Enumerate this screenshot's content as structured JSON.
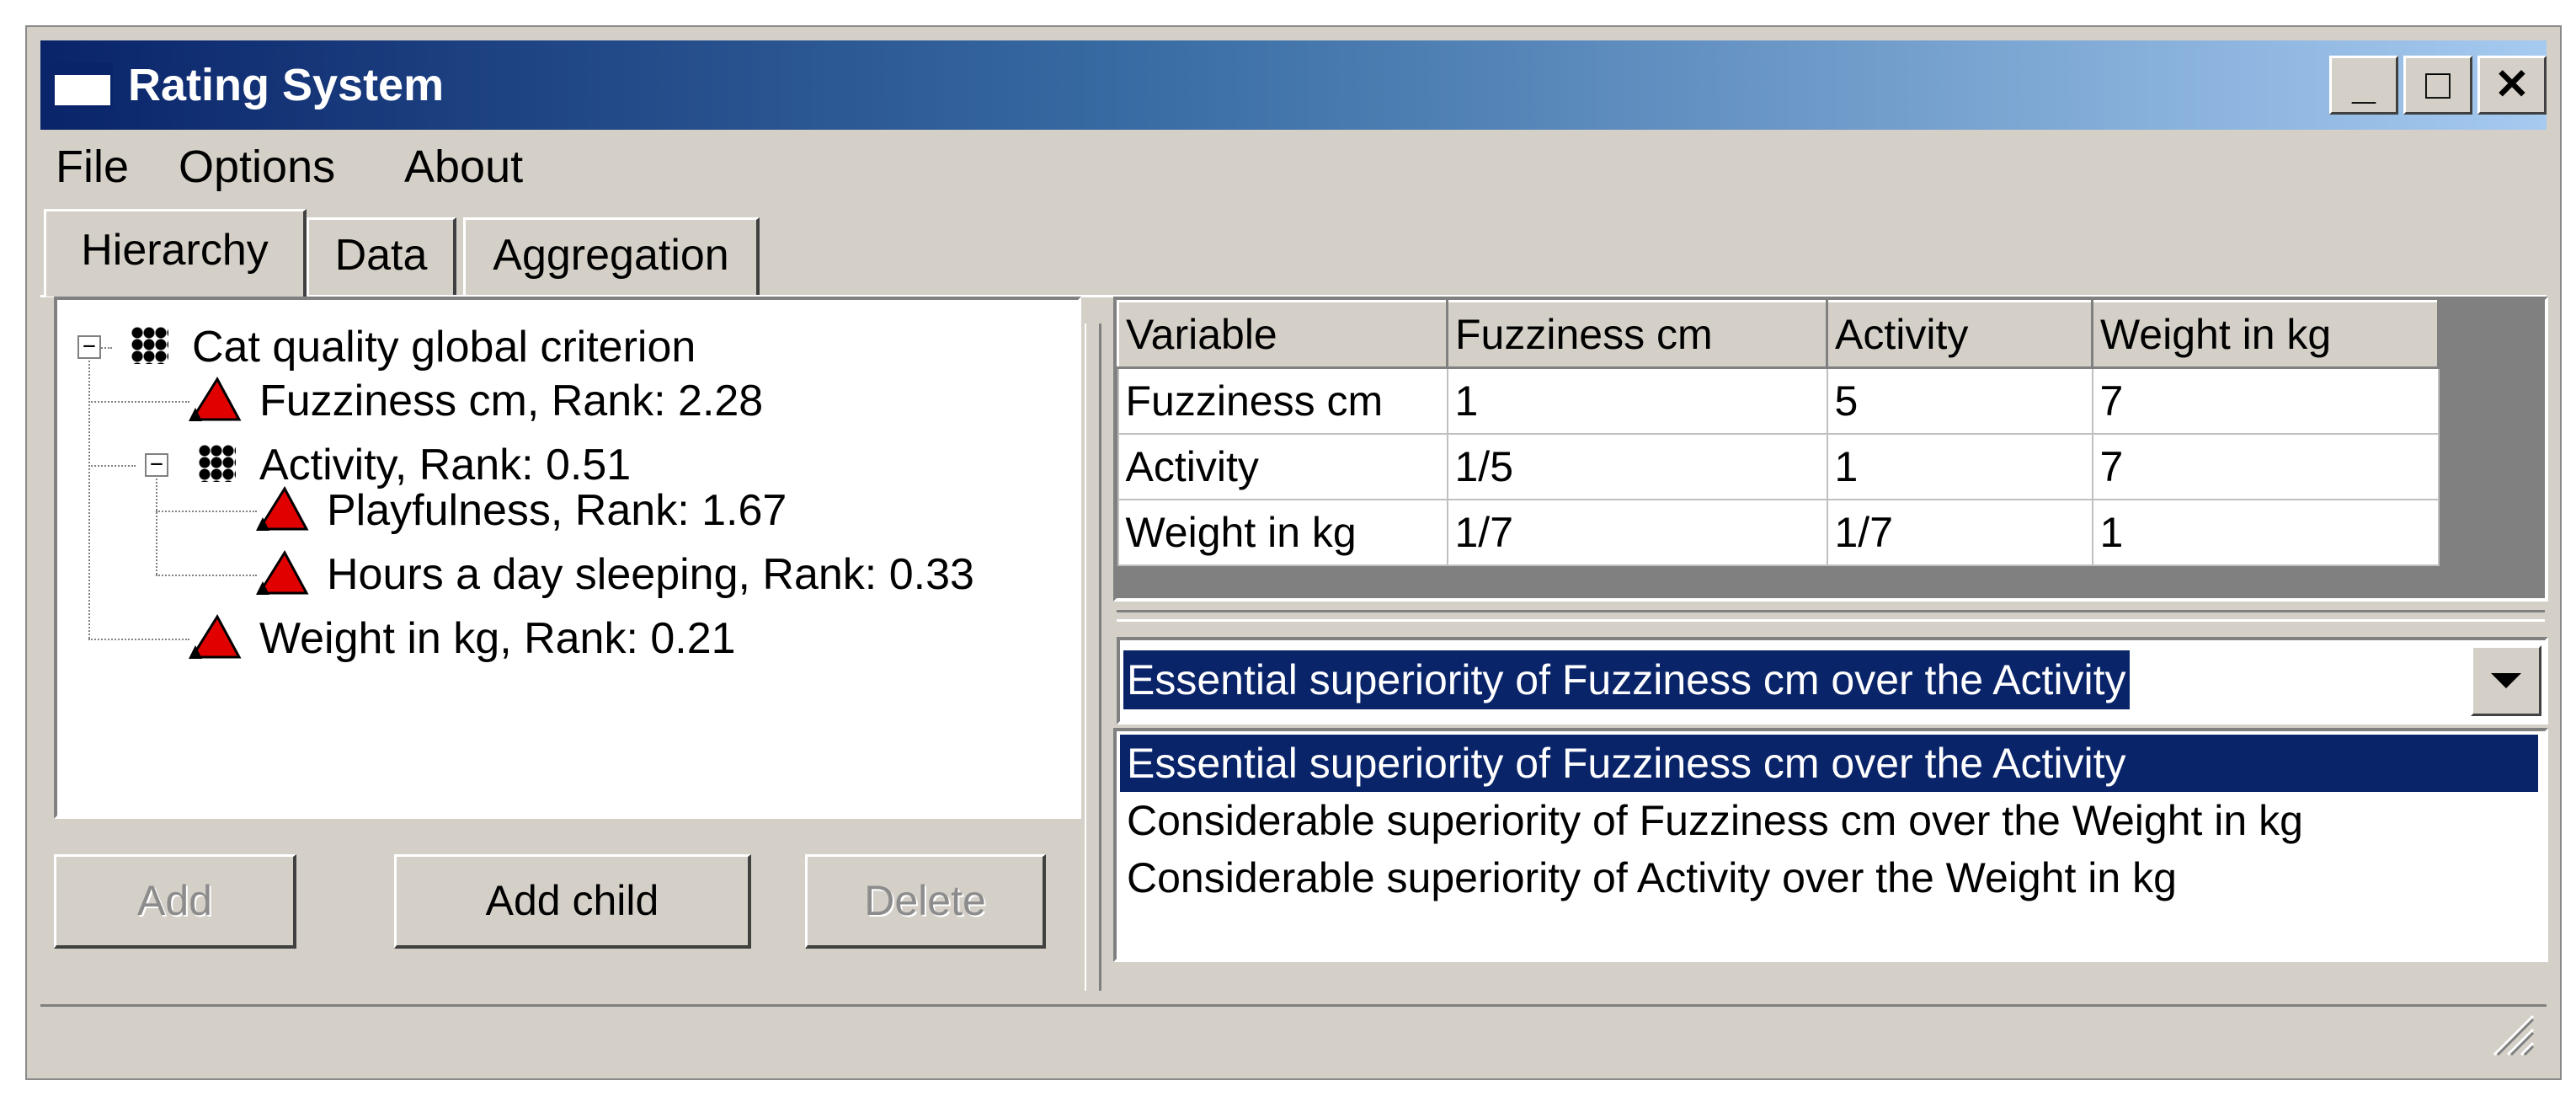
{
  "window": {
    "title": "Rating System"
  },
  "title_buttons": {
    "minimize": "_",
    "maximize": "□",
    "close": "✕"
  },
  "menu": {
    "file": "File",
    "options": "Options",
    "about": "About"
  },
  "tabs": {
    "hierarchy": "Hierarchy",
    "data": "Data",
    "aggregation": "Aggregation"
  },
  "tree": {
    "root": "Cat quality global criterion",
    "fuzziness": "Fuzziness cm, Rank: 2.28",
    "activity": "Activity, Rank: 0.51",
    "playfulness": "Playfulness, Rank: 1.67",
    "sleeping": "Hours a day sleeping, Rank: 0.33",
    "weight": "Weight in kg, Rank: 0.21",
    "expanded_glyph": "−"
  },
  "buttons": {
    "add": "Add",
    "add_child": "Add child",
    "delete": "Delete"
  },
  "matrix": {
    "headers": [
      "Variable",
      "Fuzziness cm",
      "Activity",
      "Weight in kg"
    ],
    "rows": [
      [
        "Fuzziness cm",
        "1",
        "5",
        "7"
      ],
      [
        "Activity",
        "1/5",
        "1",
        "7"
      ],
      [
        "Weight in kg",
        "1/7",
        "1/7",
        "1"
      ]
    ]
  },
  "combo": {
    "selected": "Essential superiority of Fuzziness cm over the Activity"
  },
  "list": {
    "items": [
      "Essential superiority of Fuzziness cm over the Activity",
      "Considerable superiority of Fuzziness cm over the Weight in kg",
      "Considerable superiority of Activity over the Weight in kg"
    ]
  },
  "colors": {
    "title_start": "#0a246a",
    "title_end": "#a6caf0",
    "selection": "#0a246a",
    "face": "#d4d0c8",
    "rank_icon": "#e00000"
  }
}
